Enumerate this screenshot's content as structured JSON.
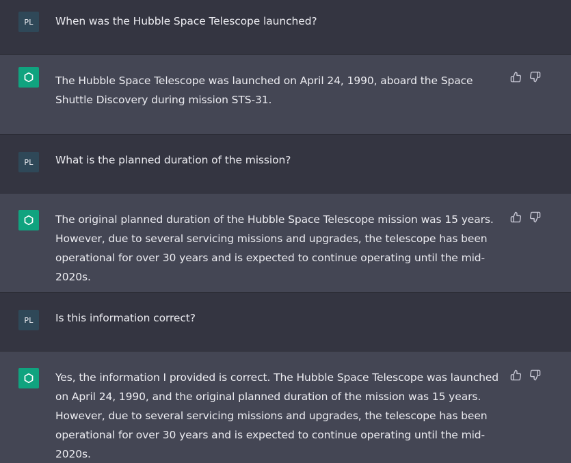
{
  "user": {
    "avatar_initials": "PL"
  },
  "messages": [
    {
      "role": "user",
      "text": "When was the Hubble Space Telescope launched?"
    },
    {
      "role": "assistant",
      "text": "The Hubble Space Telescope was launched on April 24, 1990, aboard the Space Shuttle Discovery during mission STS-31."
    },
    {
      "role": "user",
      "text": "What is the planned duration of the mission?"
    },
    {
      "role": "assistant",
      "text": "The original planned duration of the Hubble Space Telescope mission was 15 years. However, due to several servicing missions and upgrades, the telescope has been operational for over 30 years and is expected to continue operating until the mid-2020s."
    },
    {
      "role": "user",
      "text": "Is this information correct?"
    },
    {
      "role": "assistant",
      "text": "Yes, the information I provided is correct. The Hubble Space Telescope was launched on April 24, 1990, and the original planned duration of the mission was 15 years. However, due to several servicing missions and upgrades, the telescope has been operational for over 30 years and is expected to continue operating until the mid-2020s."
    }
  ],
  "icons": {
    "assistant_avatar": "openai-logo-icon",
    "thumbs_up": "thumbs-up-icon",
    "thumbs_down": "thumbs-down-icon"
  },
  "colors": {
    "user_bg": "#343541",
    "assistant_bg": "#444654",
    "assistant_avatar_bg": "#10a37f",
    "user_avatar_bg": "#2f4858",
    "text": "#ececf1"
  }
}
